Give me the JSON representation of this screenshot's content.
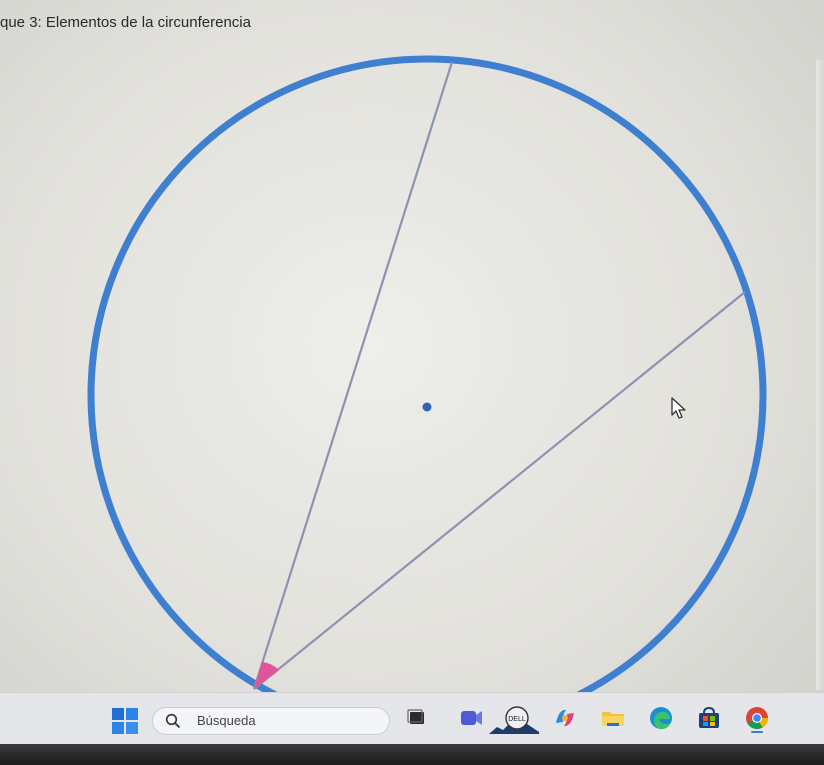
{
  "page": {
    "title": "que 3: Elementos de la circunferencia"
  },
  "geometry": {
    "circle_color": "#3f7fd0",
    "chord_color": "#8b93b0",
    "center_dot_color": "#3461b8",
    "angle_marker_color": "#e0559a"
  },
  "taskbar": {
    "search_placeholder": "Búsqueda",
    "icons": [
      "windows-start-icon",
      "search-icon",
      "weather-widget-icon",
      "task-view-icon",
      "video-call-icon",
      "dell-icon",
      "copilot-icon",
      "file-explorer-icon",
      "edge-browser-icon",
      "store-icon",
      "chrome-browser-icon"
    ]
  }
}
